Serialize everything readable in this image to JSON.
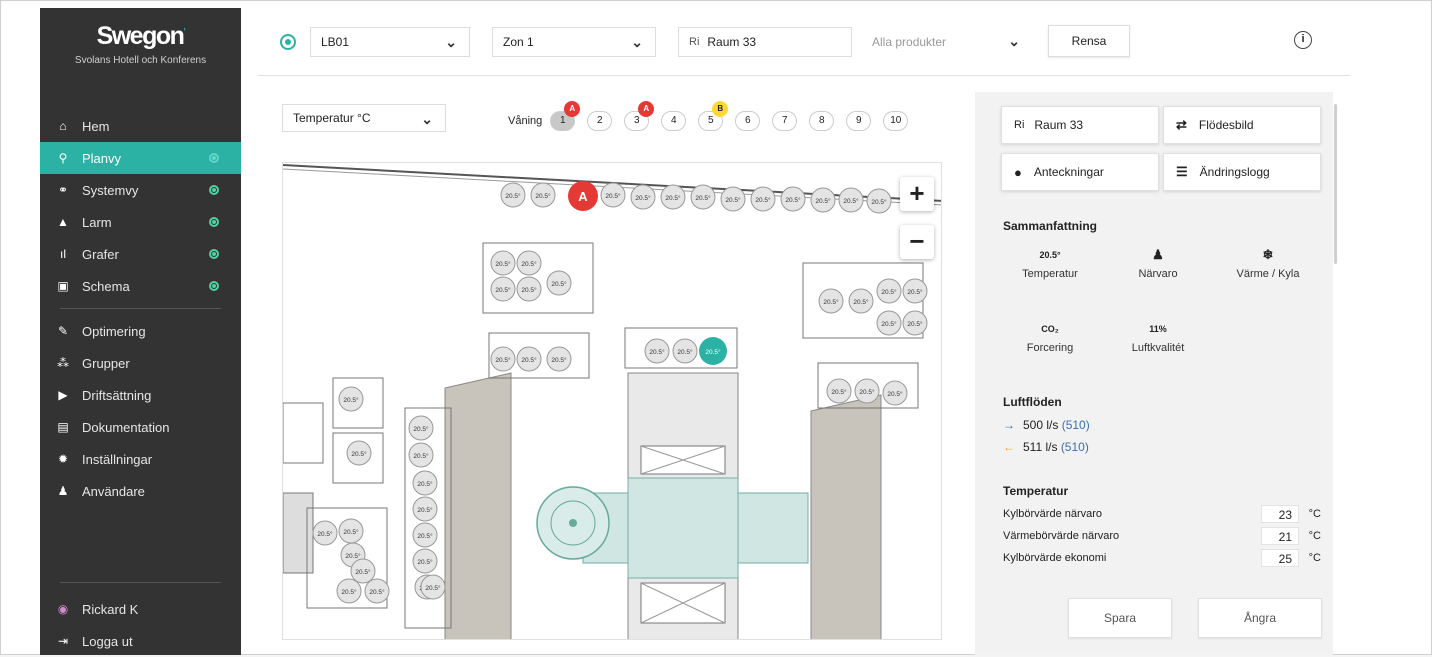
{
  "brand": {
    "logo": "Swegon",
    "site": "Svolans Hotell och Konferens"
  },
  "nav": {
    "items": [
      {
        "label": "Hem",
        "icon": "home-icon",
        "glyph": "⌂"
      },
      {
        "label": "Planvy",
        "icon": "location-pin-icon",
        "glyph": "⚲"
      },
      {
        "label": "Systemvy",
        "icon": "system-tree-icon",
        "glyph": "⚭"
      },
      {
        "label": "Larm",
        "icon": "bell-icon",
        "glyph": "▲"
      },
      {
        "label": "Grafer",
        "icon": "chart-icon",
        "glyph": "ıl"
      },
      {
        "label": "Schema",
        "icon": "calendar-icon",
        "glyph": "▣"
      },
      {
        "label": "Optimering",
        "icon": "wrench-icon",
        "glyph": "✎"
      },
      {
        "label": "Grupper",
        "icon": "group-icon",
        "glyph": "⁂"
      },
      {
        "label": "Driftsättning",
        "icon": "play-icon",
        "glyph": "▶"
      },
      {
        "label": "Dokumentation",
        "icon": "document-icon",
        "glyph": "▤"
      },
      {
        "label": "Inställningar",
        "icon": "gear-icon",
        "glyph": "✹"
      },
      {
        "label": "Användare",
        "icon": "user-icon",
        "glyph": "♟"
      }
    ],
    "user": "Rickard K",
    "logout": "Logga ut"
  },
  "topbar": {
    "building": "LB01",
    "zone": "Zon 1",
    "room_prefix": "Ri",
    "room": "Raum 33",
    "products": "Alla produkter",
    "clear": "Rensa",
    "info": "i"
  },
  "map": {
    "mode": "Temperatur °C",
    "floor_label": "Våning",
    "floors": [
      "1",
      "2",
      "3",
      "4",
      "5",
      "6",
      "7",
      "8",
      "9",
      "10"
    ],
    "selected_floor": "1",
    "floor_badges": {
      "1": "A",
      "3": "A",
      "5": "B"
    },
    "zoom_in": "+",
    "zoom_out": "−",
    "temp_value": "20.5°",
    "alarm_marker": "A",
    "selected_room_value": "20.5°",
    "accent": "#2bb2a4",
    "alarm_color": "#e53935"
  },
  "panel": {
    "room_prefix": "Ri",
    "room": "Raum 33",
    "flow_diagram": "Flödesbild",
    "notes": "Anteckningar",
    "changelog": "Ändringslogg",
    "summary_title": "Sammanfattning",
    "summary": [
      {
        "value": "20.5°",
        "label": "Temperatur"
      },
      {
        "value": "♟",
        "label": "Närvaro"
      },
      {
        "value": "❄",
        "label": "Värme / Kyla"
      },
      {
        "value": "CO₂",
        "label": "Forcering"
      },
      {
        "value": "11%",
        "label": "Luftkvalitét"
      }
    ],
    "airflow_title": "Luftflöden",
    "airflow": [
      {
        "arrow": "→",
        "value": "500 l/s",
        "paren": "(510)",
        "color": "#1e73be"
      },
      {
        "arrow": "←",
        "value": "511 l/s",
        "paren": "(510)",
        "color": "#f0a030"
      }
    ],
    "temp_title": "Temperatur",
    "temps": [
      {
        "label": "Kylbörvärde närvaro",
        "value": "23",
        "unit": "°C"
      },
      {
        "label": "Värmebörvärde närvaro",
        "value": "21",
        "unit": "°C"
      },
      {
        "label": "Kylbörvärde ekonomi",
        "value": "25",
        "unit": "°C"
      }
    ],
    "save": "Spara",
    "undo": "Ångra"
  }
}
